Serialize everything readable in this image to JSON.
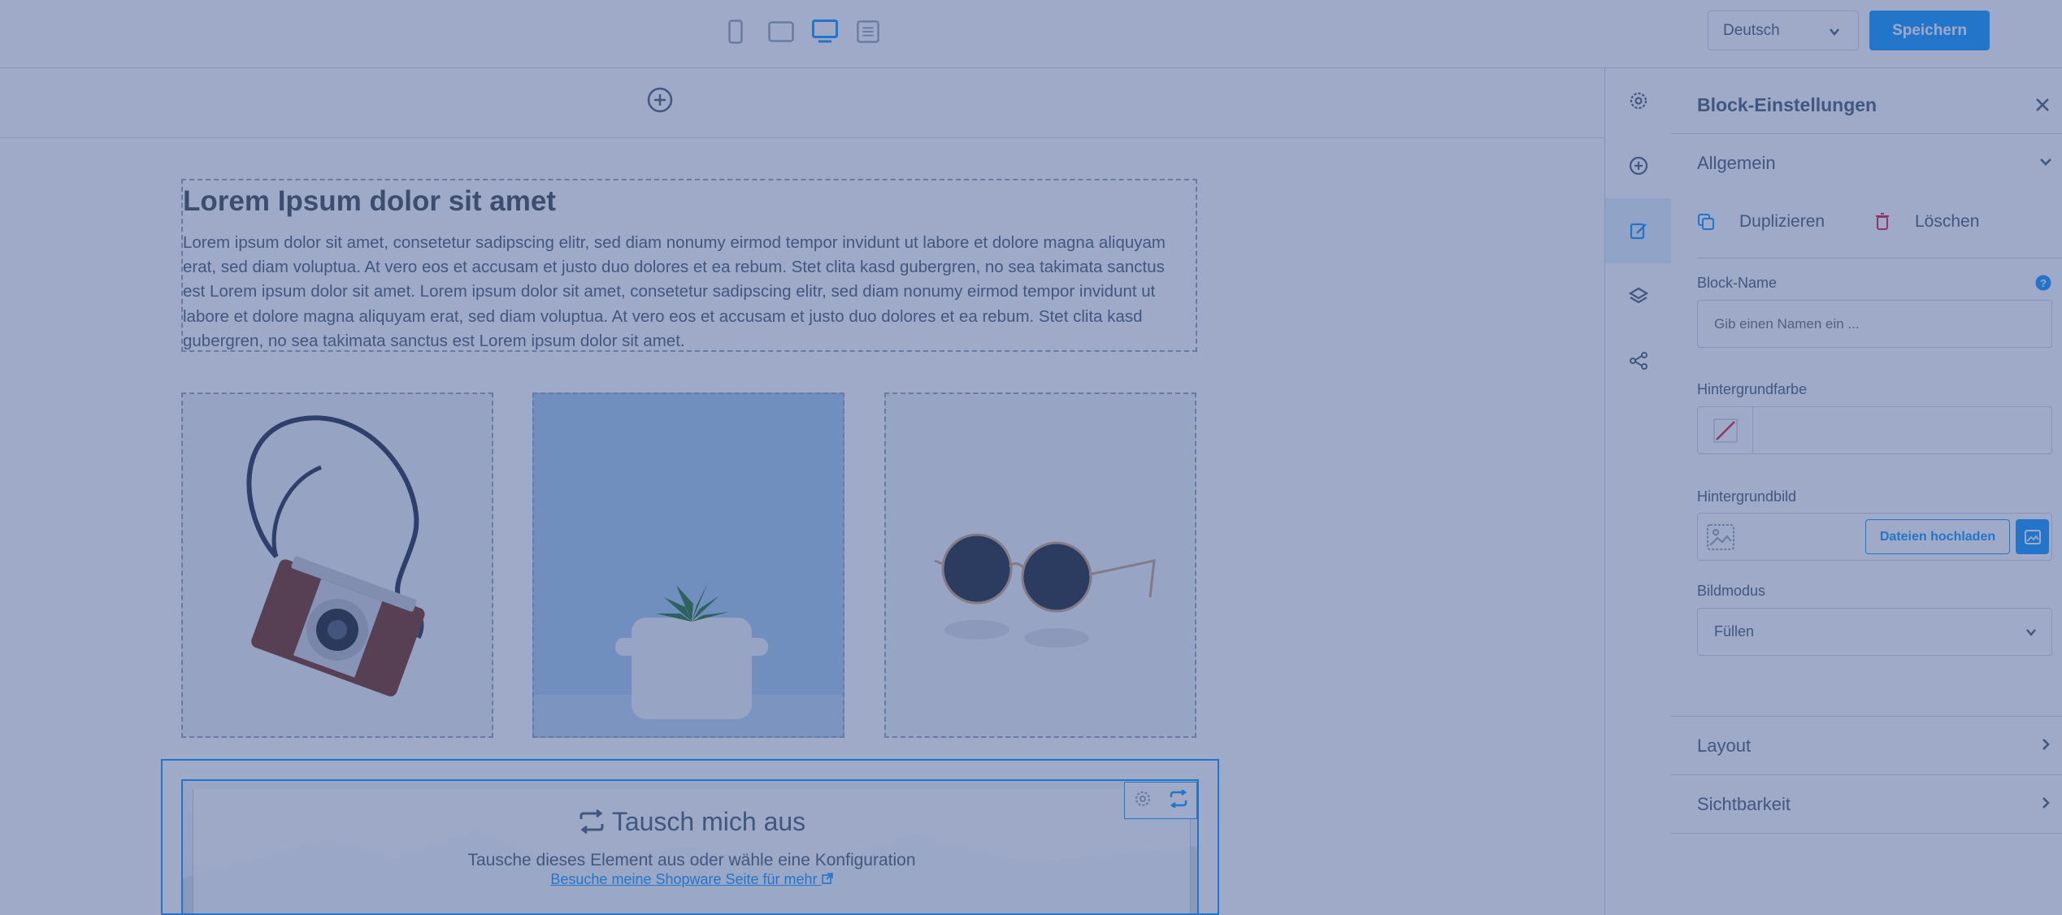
{
  "topbar": {
    "devices": [
      "mobile-view",
      "tablet-view",
      "desktop-view",
      "list-view"
    ],
    "language": "Deutsch",
    "save_label": "Speichern"
  },
  "canvas": {
    "text_block": {
      "title": "Lorem Ipsum dolor sit amet",
      "body": "Lorem ipsum dolor sit amet, consetetur sadipscing elitr, sed diam nonumy eirmod tempor invidunt ut labore et dolore magna aliquyam erat, sed diam voluptua. At vero eos et accusam et justo duo dolores et ea rebum. Stet clita kasd gubergren, no sea takimata sanctus est Lorem ipsum dolor sit amet. Lorem ipsum dolor sit amet, consetetur sadipscing elitr, sed diam nonumy eirmod tempor invidunt ut labore et dolore magna aliquyam erat, sed diam voluptua. At vero eos et accusam et justo duo dolores et ea rebum. Stet clita kasd gubergren, no sea takimata sanctus est Lorem ipsum dolor sit amet."
    },
    "images": [
      "camera",
      "plant",
      "sunglasses"
    ],
    "swap_block": {
      "title": "Tausch mich aus",
      "subtitle": "Tausche dieses Element aus oder wähle eine Konfiguration",
      "link": "Besuche meine Shopware Seite für mehr"
    }
  },
  "sidebar": {
    "title": "Block-Einstellungen",
    "general_section": "Allgemein",
    "duplicate_label": "Duplizieren",
    "delete_label": "Löschen",
    "block_name_label": "Block-Name",
    "block_name_placeholder": "Gib einen Namen ein ...",
    "bg_color_label": "Hintergrundfarbe",
    "bg_image_label": "Hintergrundbild",
    "upload_label": "Dateien hochladen",
    "image_mode_label": "Bildmodus",
    "image_mode_value": "Füllen",
    "layout_section": "Layout",
    "visibility_section": "Sichtbarkeit"
  },
  "colors": {
    "accent": "#189eff",
    "overlay": "#2d4687"
  }
}
